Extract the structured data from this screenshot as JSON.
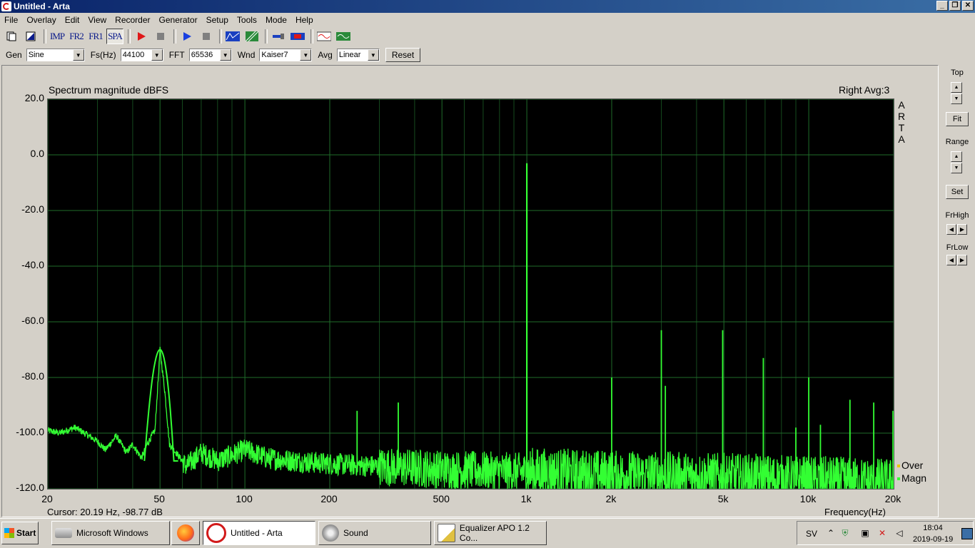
{
  "window": {
    "title": "Untitled - Arta",
    "min": "_",
    "max": "❐",
    "close": "✕"
  },
  "menu": [
    "File",
    "Overlay",
    "Edit",
    "View",
    "Recorder",
    "Generator",
    "Setup",
    "Tools",
    "Mode",
    "Help"
  ],
  "toolbar": {
    "imp": "IMP",
    "fr2": "FR2",
    "fr1": "FR1",
    "spa": "SPA"
  },
  "options": {
    "gen_label": "Gen",
    "gen_value": "Sine",
    "fs_label": "Fs(Hz)",
    "fs_value": "44100",
    "fft_label": "FFT",
    "fft_value": "65536",
    "wnd_label": "Wnd",
    "wnd_value": "Kaiser7",
    "avg_label": "Avg",
    "avg_value": "Linear",
    "reset_label": "Reset"
  },
  "plot": {
    "title": "Spectrum magnitude dBFS",
    "channel_info": "Right  Avg:3",
    "brand": [
      "A",
      "R",
      "T",
      "A"
    ],
    "legend": [
      {
        "label": "Over",
        "color": "#e8c800"
      },
      {
        "label": "Magn",
        "color": "#33ff33"
      }
    ],
    "cursor": "Cursor: 20.19 Hz, -98.77 dB",
    "xlabel": "Frequency(Hz)"
  },
  "side": {
    "top_label": "Top",
    "fit_label": "Fit",
    "range_label": "Range",
    "set_label": "Set",
    "frhigh_label": "FrHigh",
    "frlow_label": "FrLow"
  },
  "chart_data": {
    "type": "line",
    "title": "Spectrum magnitude dBFS",
    "xlabel": "Frequency(Hz)",
    "ylabel": "",
    "x_scale": "log",
    "xlim": [
      20,
      20000
    ],
    "ylim": [
      -120,
      20
    ],
    "grid": true,
    "y_ticks": [
      "20.0",
      "0.0",
      "-20.0",
      "-40.0",
      "-60.0",
      "-80.0",
      "-100.0",
      "-120.0"
    ],
    "x_ticks": [
      {
        "v": 20,
        "label": "20"
      },
      {
        "v": 50,
        "label": "50"
      },
      {
        "v": 100,
        "label": "100"
      },
      {
        "v": 200,
        "label": "200"
      },
      {
        "v": 500,
        "label": "500"
      },
      {
        "v": 1000,
        "label": "1k"
      },
      {
        "v": 2000,
        "label": "2k"
      },
      {
        "v": 5000,
        "label": "5k"
      },
      {
        "v": 10000,
        "label": "10k"
      },
      {
        "v": 20000,
        "label": "20k"
      }
    ],
    "series": [
      {
        "name": "Magn",
        "color": "#33ff33",
        "noise_floor": [
          [
            20,
            -99
          ],
          [
            22,
            -100
          ],
          [
            25,
            -98
          ],
          [
            28,
            -101
          ],
          [
            30,
            -103
          ],
          [
            32,
            -106
          ],
          [
            35,
            -101
          ],
          [
            38,
            -107
          ],
          [
            40,
            -104
          ],
          [
            43,
            -109
          ],
          [
            45,
            -104
          ],
          [
            48,
            -99
          ],
          [
            50,
            -70
          ],
          [
            52,
            -85
          ],
          [
            54,
            -104
          ],
          [
            58,
            -108
          ],
          [
            62,
            -112
          ],
          [
            70,
            -107
          ],
          [
            80,
            -110
          ],
          [
            100,
            -106
          ],
          [
            120,
            -109
          ],
          [
            150,
            -110
          ],
          [
            200,
            -111
          ],
          [
            300,
            -112
          ],
          [
            500,
            -113
          ],
          [
            1000,
            -114
          ],
          [
            2000,
            -115
          ],
          [
            5000,
            -116
          ],
          [
            10000,
            -117
          ],
          [
            20000,
            -118
          ]
        ],
        "peaks": [
          {
            "f": 50,
            "db": -70
          },
          {
            "f": 250,
            "db": -92
          },
          {
            "f": 350,
            "db": -89
          },
          {
            "f": 1000,
            "db": -3
          },
          {
            "f": 2000,
            "db": -80
          },
          {
            "f": 3000,
            "db": -63
          },
          {
            "f": 3100,
            "db": -83
          },
          {
            "f": 4950,
            "db": -63
          },
          {
            "f": 6900,
            "db": -73
          },
          {
            "f": 9000,
            "db": -98
          },
          {
            "f": 10000,
            "db": -80
          },
          {
            "f": 11000,
            "db": -97
          },
          {
            "f": 14000,
            "db": -88
          },
          {
            "f": 17000,
            "db": -89
          },
          {
            "f": 19900,
            "db": -92
          }
        ]
      }
    ]
  },
  "taskbar": {
    "start": "Start",
    "items": [
      {
        "label": "Microsoft Windows",
        "active": false
      },
      {
        "label": "",
        "active": false
      },
      {
        "label": "Untitled - Arta",
        "active": true
      },
      {
        "label": "Sound",
        "active": false
      },
      {
        "label": "Equalizer APO 1.2 Co...",
        "active": false
      }
    ],
    "lang": "SV",
    "time": "18:04",
    "date": "2019-09-19"
  }
}
